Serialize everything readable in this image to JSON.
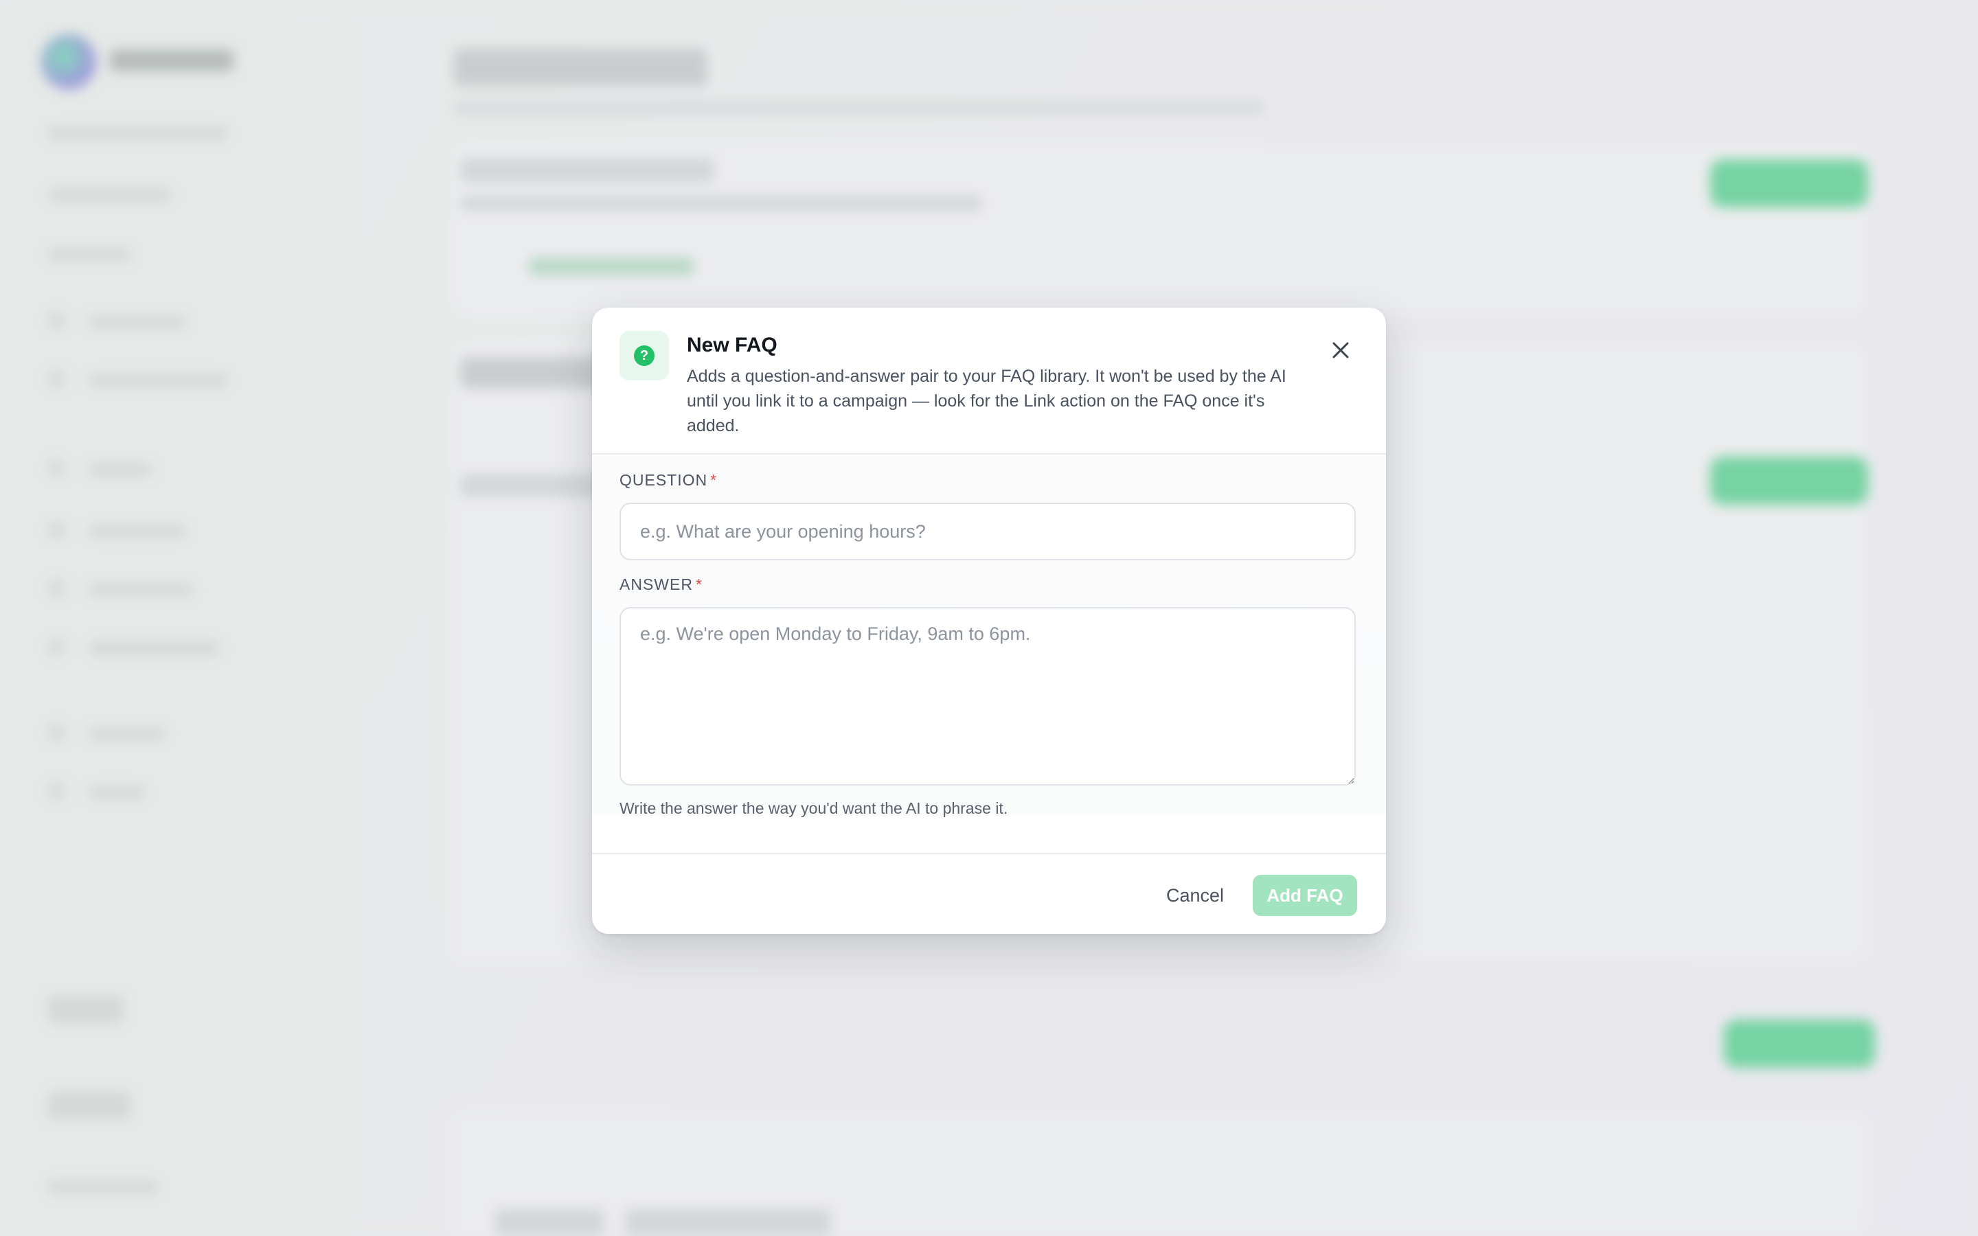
{
  "modal": {
    "title": "New FAQ",
    "description": "Adds a question-and-answer pair to your FAQ library. It won't be used by the AI until you link it to a campaign — look for the Link action on the FAQ once it's added.",
    "header_icon": "question-circle-icon",
    "close_icon": "close-icon",
    "question": {
      "label": "QUESTION",
      "required_mark": "*",
      "value": "",
      "placeholder": "e.g. What are your opening hours?"
    },
    "answer": {
      "label": "ANSWER",
      "required_mark": "*",
      "value": "",
      "placeholder": "e.g. We're open Monday to Friday, 9am to 6pm.",
      "hint": "Write the answer the way you'd want the AI to phrase it."
    },
    "cancel_label": "Cancel",
    "submit_label": "Add FAQ"
  },
  "colors": {
    "accent": "#24c067",
    "submit_disabled": "#a3e4c0",
    "required": "#e04848"
  }
}
